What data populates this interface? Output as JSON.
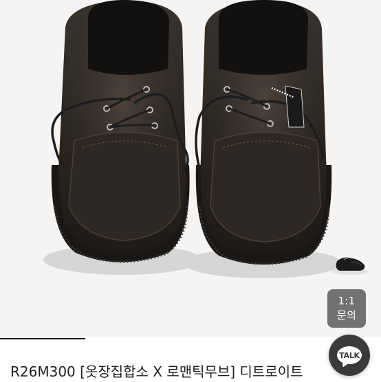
{
  "product": {
    "title": "R26M300 [옷장집합소 X 로맨틱무브] 디트로이트",
    "image_alt": "black leather boat shoes with chunky sole",
    "thumbnail_alt": "shoe thumbnail"
  },
  "inquiry_button": {
    "line1": "1:1",
    "line2": "문의"
  },
  "chat_button": {
    "label": "TALK"
  },
  "colors": {
    "leather": "#2b2622",
    "lace": "#222222",
    "background": "#f4f4f4",
    "inquiry_bg": "#727272",
    "chat_bg": "#3a3a3a"
  }
}
